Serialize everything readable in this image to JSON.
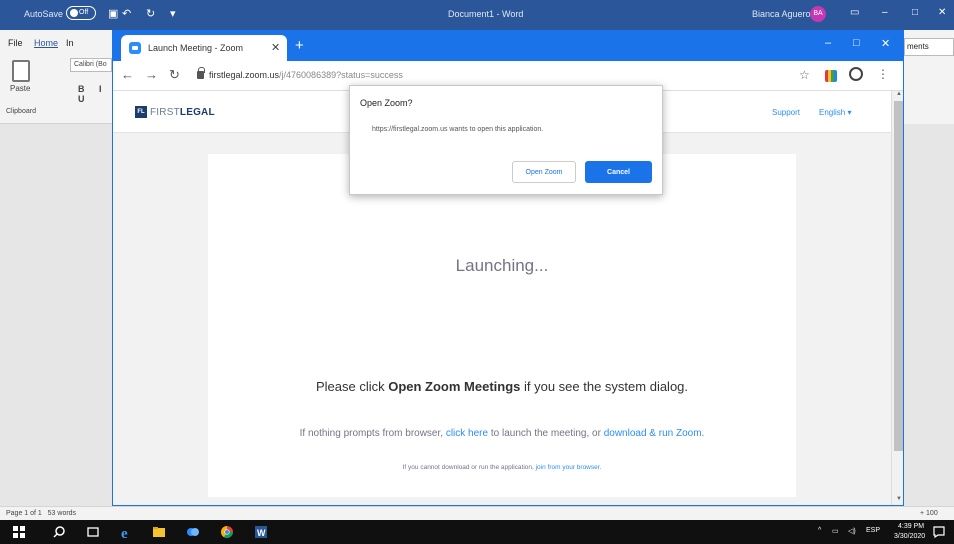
{
  "word": {
    "autosave_label": "AutoSave",
    "autosave_state": "Off",
    "doc_title": "Document1 - Word",
    "user_name": "Bianca Aguero",
    "user_initials": "BA",
    "tabs": {
      "file": "File",
      "home": "Home",
      "insert": "In"
    },
    "paste_label": "Paste",
    "font_name": "Calibri (Bo",
    "format_buttons": "B I U",
    "clipboard_label": "Clipboard",
    "comments_label": "ments",
    "status_page": "Page 1 of 1",
    "status_words": "53 words",
    "zoom": "+ 100"
  },
  "chrome": {
    "tab_title": "Launch Meeting - Zoom",
    "url_host": "firstlegal.zoom.us",
    "url_rest": "/j/4760086389?status=success"
  },
  "site": {
    "logo_mark": "FL",
    "logo_first": "FIRST",
    "logo_second": "LEGAL",
    "support": "Support",
    "language": "English ▾",
    "launching": "Launching...",
    "please_prefix": "Please click ",
    "please_bold": "Open Zoom Meetings",
    "please_suffix": " if you see the system dialog.",
    "nothing_prefix": "If nothing prompts from browser, ",
    "nothing_link1": "click here",
    "nothing_mid": " to launch the meeting, or ",
    "nothing_link2": "download & run Zoom",
    "nothing_suffix": ".",
    "cannot_prefix": "If you cannot download or run the application, ",
    "cannot_link": "join from your browser",
    "cannot_suffix": "."
  },
  "dialog": {
    "title": "Open Zoom?",
    "message": "https://firstlegal.zoom.us wants to open this application.",
    "open_label": "Open Zoom",
    "cancel_label": "Cancel"
  },
  "taskbar": {
    "time": "4:39 PM",
    "date": "3/30/2020",
    "lang": "ESP"
  }
}
